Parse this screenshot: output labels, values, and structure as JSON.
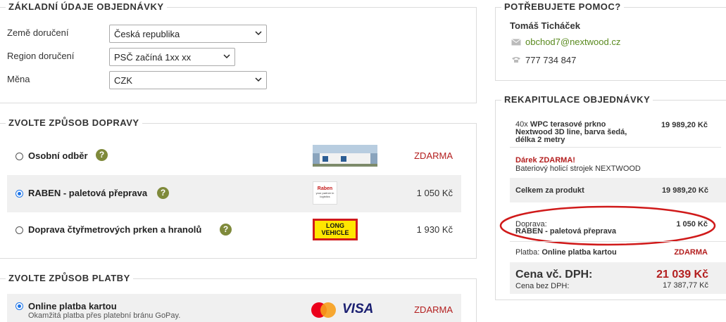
{
  "basic": {
    "title": "ZÁKLADNÍ ÚDAJE OBJEDNÁVKY",
    "country_label": "Země doručení",
    "country_value": "Česká republika",
    "region_label": "Region doručení",
    "region_value": "PSČ začíná 1xx xx",
    "currency_label": "Měna",
    "currency_value": "CZK"
  },
  "shipping": {
    "title": "ZVOLTE ZPŮSOB DOPRAVY",
    "options": [
      {
        "label": "Osobní odběr",
        "price": "ZDARMA",
        "selected": false
      },
      {
        "label": "RABEN - paletová přeprava",
        "price": "1 050 Kč",
        "selected": true,
        "logo_text_1": "Raben",
        "logo_text_2": "your partner in logistics"
      },
      {
        "label": "Doprava čtyřmetrových prken a hranolů",
        "price": "1 930 Kč",
        "selected": false,
        "logo_text_1": "LONG",
        "logo_text_2": "VEHICLE"
      }
    ]
  },
  "payment": {
    "title": "ZVOLTE ZPŮSOB PLATBY",
    "option_label": "Online platba kartou",
    "option_desc": "Okamžitá platba přes platební bránu GoPay.",
    "visa_text": "VISA",
    "price": "ZDARMA"
  },
  "help": {
    "title": "POTŘEBUJETE POMOC?",
    "name": "Tomáš Ticháček",
    "email": "obchod7@nextwood.cz",
    "phone": "777 734 847"
  },
  "recap": {
    "title": "REKAPITULACE OBJEDNÁVKY",
    "qty": "40x",
    "product_line1": "WPC terasové prkno",
    "product_line2": "Nextwood 3D line, barva šedá,",
    "product_line3": "délka 2 metry",
    "product_price": "19 989,20 Kč",
    "gift_title": "Dárek ZDARMA!",
    "gift_desc": "Bateriový holicí strojek NEXTWOOD",
    "total_product_label": "Celkem za produkt",
    "total_product_value": "19 989,20 Kč",
    "shipping_label": "Doprava:",
    "shipping_name": "RABEN - paletová přeprava",
    "shipping_price": "1 050 Kč",
    "payment_label": "Platba:",
    "payment_name": "Online platba kartou",
    "payment_price": "ZDARMA",
    "total_label": "Cena vč. DPH:",
    "total_value": "21 039 Kč",
    "net_label": "Cena bez DPH:",
    "net_value": "17 387,77 Kč"
  },
  "colors": {
    "accent_red": "#b31e1e",
    "help_green": "#7f8a3b",
    "radio_blue": "#1a73e8",
    "email_green": "#5a8a1f",
    "annotation_red": "#d01a1a"
  }
}
